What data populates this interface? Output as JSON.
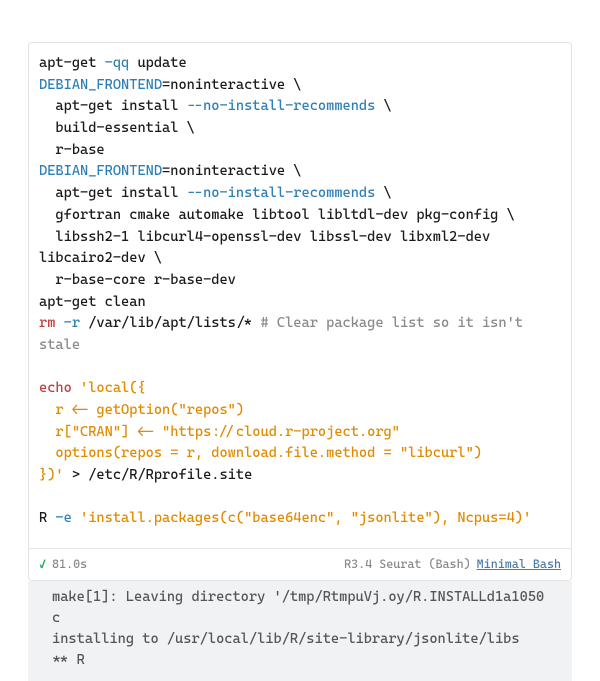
{
  "code_tokens": [
    {
      "t": "apt-get ",
      "c": "tok-plain"
    },
    {
      "t": "-qq",
      "c": "tok-flag"
    },
    {
      "t": " update",
      "c": "tok-plain"
    },
    {
      "nl": true
    },
    {
      "t": "DEBIAN_FRONTEND",
      "c": "tok-env"
    },
    {
      "t": "=noninteractive \\",
      "c": "tok-plain"
    },
    {
      "nl": true
    },
    {
      "t": "  apt-get install ",
      "c": "tok-plain"
    },
    {
      "t": "--no-install-recommends",
      "c": "tok-longflag"
    },
    {
      "t": " \\",
      "c": "tok-plain"
    },
    {
      "nl": true
    },
    {
      "t": "  build-essential \\",
      "c": "tok-plain"
    },
    {
      "nl": true
    },
    {
      "t": "  r-base",
      "c": "tok-plain"
    },
    {
      "nl": true
    },
    {
      "t": "DEBIAN_FRONTEND",
      "c": "tok-env"
    },
    {
      "t": "=noninteractive \\",
      "c": "tok-plain"
    },
    {
      "nl": true
    },
    {
      "t": "  apt-get install ",
      "c": "tok-plain"
    },
    {
      "t": "--no-install-recommends",
      "c": "tok-longflag"
    },
    {
      "t": " \\",
      "c": "tok-plain"
    },
    {
      "nl": true
    },
    {
      "t": "  gfortran cmake automake libtool libltdl-dev pkg-config \\",
      "c": "tok-plain"
    },
    {
      "nl": true
    },
    {
      "t": "  libssh2-1 libcurl4-openssl-dev libssl-dev libxml2-dev libcairo2-dev \\",
      "c": "tok-plain"
    },
    {
      "nl": true
    },
    {
      "t": "  r-base-core r-base-dev",
      "c": "tok-plain"
    },
    {
      "nl": true
    },
    {
      "t": "apt-get clean",
      "c": "tok-plain"
    },
    {
      "nl": true
    },
    {
      "t": "rm",
      "c": "tok-cmd"
    },
    {
      "t": " ",
      "c": "tok-plain"
    },
    {
      "t": "-r",
      "c": "tok-flag"
    },
    {
      "t": " /var/lib/apt/lists/* ",
      "c": "tok-plain"
    },
    {
      "t": "# Clear package list so it isn't stale",
      "c": "tok-comment"
    },
    {
      "nl": true
    },
    {
      "nl": true
    },
    {
      "t": "echo",
      "c": "tok-cmd"
    },
    {
      "t": " ",
      "c": "tok-plain"
    },
    {
      "t": "'local({",
      "c": "tok-str"
    },
    {
      "nl": true
    },
    {
      "t": "  r <- getOption(\"repos\")",
      "c": "tok-str"
    },
    {
      "nl": true
    },
    {
      "t": "  r[\"CRAN\"] <- \"https://cloud.r-project.org\"",
      "c": "tok-str"
    },
    {
      "nl": true
    },
    {
      "t": "  options(repos = r, download.file.method = \"libcurl\")",
      "c": "tok-str"
    },
    {
      "nl": true
    },
    {
      "t": "})'",
      "c": "tok-str"
    },
    {
      "t": " > /etc/R/Rprofile.site",
      "c": "tok-plain"
    },
    {
      "nl": true
    },
    {
      "nl": true
    },
    {
      "t": "R ",
      "c": "tok-plain"
    },
    {
      "t": "-e",
      "c": "tok-flag"
    },
    {
      "t": " ",
      "c": "tok-plain"
    },
    {
      "t": "'install.packages(c(\"base64enc\", \"jsonlite\"), Ncpus=4)'",
      "c": "tok-str"
    }
  ],
  "status": {
    "time": "81.0s",
    "label": "R3.4 Seurat (Bash)",
    "tag": "Minimal Bash"
  },
  "output_lines": [
    "make[1]: Leaving directory '/tmp/RtmpuVj.oy/R.INSTALLd1a1050c",
    "installing to /usr/local/lib/R/site-library/jsonlite/libs",
    "** R"
  ]
}
